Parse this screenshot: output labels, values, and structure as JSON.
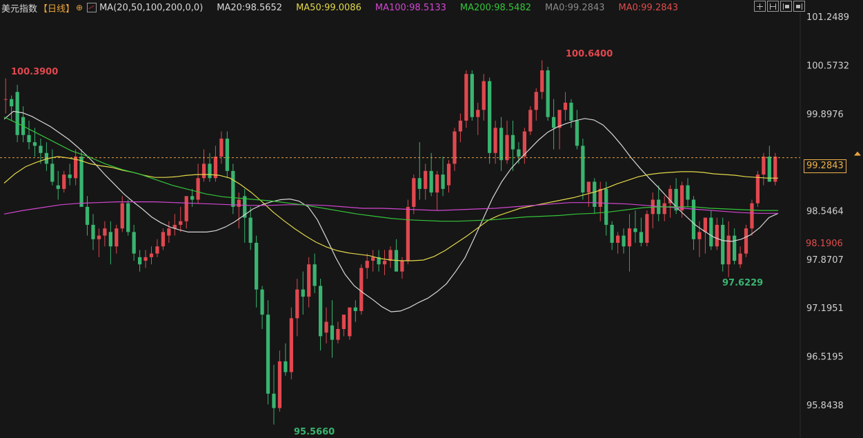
{
  "legend": {
    "instrument": "美元指数",
    "period": "【日线】",
    "period_ctrl": "⊕",
    "ma_params": "MA(20,50,100,200,0,0)",
    "items": [
      {
        "label": "MA20:98.5652",
        "color": "#d8d8d8"
      },
      {
        "label": "MA50:99.0086",
        "color": "#e3d94a"
      },
      {
        "label": "MA100:98.5133",
        "color": "#d347d3"
      },
      {
        "label": "MA200:98.5482",
        "color": "#34c63a"
      },
      {
        "label": "MA0:99.2843",
        "color": "#8a8a8a"
      },
      {
        "label": "MA0:99.2843",
        "color": "#e04c4c"
      }
    ]
  },
  "toolbar": [
    "zoom-in-icon",
    "zoom-out-icon",
    "step-left-icon",
    "step-right-icon"
  ],
  "price_tags": {
    "last": "99.2843",
    "ref": "98.1906"
  },
  "annotations": {
    "start_high": "100.3900",
    "peak_high": "100.6400",
    "low": "95.5660",
    "recent_low": "97.6229"
  },
  "chart_data": {
    "type": "candlestick",
    "y_ticks": [
      "101.2489",
      "100.5732",
      "99.8976",
      "99.2843",
      "98.5464",
      "98.1906",
      "97.8707",
      "97.1951",
      "96.5195",
      "95.8438"
    ],
    "ylim": [
      95.5,
      101.3
    ],
    "colors": {
      "up": "#e0484f",
      "down": "#39b470",
      "background": "#161616",
      "last_line": "#e8a33a"
    },
    "ohlc": [
      [
        100.1,
        100.39,
        99.9,
        100.1
      ],
      [
        100.1,
        100.15,
        99.8,
        100.0
      ],
      [
        100.2,
        100.3,
        99.5,
        99.6
      ],
      [
        99.85,
        100.0,
        99.5,
        99.6
      ],
      [
        99.6,
        99.8,
        99.4,
        99.5
      ],
      [
        99.5,
        99.7,
        99.3,
        99.45
      ],
      [
        99.45,
        99.55,
        99.2,
        99.35
      ],
      [
        99.35,
        99.5,
        99.1,
        99.2
      ],
      [
        99.2,
        99.4,
        98.9,
        98.95
      ],
      [
        98.9,
        99.1,
        98.7,
        98.85
      ],
      [
        98.85,
        99.1,
        98.8,
        99.05
      ],
      [
        99.05,
        99.2,
        98.9,
        99.0
      ],
      [
        99.0,
        99.4,
        98.9,
        99.3
      ],
      [
        99.3,
        99.4,
        98.6,
        98.6
      ],
      [
        98.6,
        98.75,
        98.2,
        98.35
      ],
      [
        98.35,
        98.5,
        98.0,
        98.15
      ],
      [
        98.15,
        98.3,
        97.9,
        98.2
      ],
      [
        98.2,
        98.4,
        98.05,
        98.3
      ],
      [
        98.25,
        98.4,
        97.8,
        98.05
      ],
      [
        98.05,
        98.35,
        97.95,
        98.3
      ],
      [
        98.3,
        98.75,
        98.25,
        98.65
      ],
      [
        98.65,
        98.7,
        98.2,
        98.25
      ],
      [
        98.25,
        98.35,
        97.85,
        97.95
      ],
      [
        97.9,
        98.0,
        97.7,
        97.8
      ],
      [
        97.85,
        98.0,
        97.75,
        97.9
      ],
      [
        97.9,
        98.05,
        97.8,
        97.95
      ],
      [
        97.95,
        98.15,
        97.9,
        98.05
      ],
      [
        98.05,
        98.3,
        98.0,
        98.25
      ],
      [
        98.2,
        98.4,
        98.1,
        98.3
      ],
      [
        98.3,
        98.5,
        98.2,
        98.35
      ],
      [
        98.35,
        98.6,
        98.25,
        98.4
      ],
      [
        98.4,
        98.7,
        98.3,
        98.75
      ],
      [
        98.75,
        98.85,
        98.6,
        98.7
      ],
      [
        98.7,
        99.2,
        98.65,
        99.0
      ],
      [
        99.0,
        99.4,
        98.95,
        99.2
      ],
      [
        99.2,
        99.35,
        98.95,
        99.0
      ],
      [
        99.0,
        99.45,
        98.95,
        99.3
      ],
      [
        99.3,
        99.65,
        99.2,
        99.55
      ],
      [
        99.55,
        99.65,
        99.0,
        99.1
      ],
      [
        99.1,
        99.2,
        98.5,
        98.6
      ],
      [
        98.6,
        98.8,
        98.3,
        98.7
      ],
      [
        98.75,
        98.85,
        98.1,
        98.45
      ],
      [
        98.45,
        98.6,
        98.0,
        98.1
      ],
      [
        98.1,
        98.2,
        97.2,
        97.45
      ],
      [
        97.45,
        97.5,
        96.9,
        97.1
      ],
      [
        97.1,
        97.3,
        95.85,
        96.0
      ],
      [
        96.0,
        96.4,
        95.57,
        95.8
      ],
      [
        95.8,
        96.6,
        95.75,
        96.45
      ],
      [
        96.45,
        96.7,
        96.25,
        96.3
      ],
      [
        96.3,
        97.2,
        96.2,
        97.05
      ],
      [
        97.05,
        97.6,
        96.8,
        97.45
      ],
      [
        97.45,
        97.7,
        97.1,
        97.35
      ],
      [
        97.35,
        97.9,
        97.2,
        97.8
      ],
      [
        97.8,
        97.95,
        97.4,
        97.5
      ],
      [
        97.5,
        97.6,
        96.6,
        96.8
      ],
      [
        96.85,
        97.2,
        96.7,
        97.0
      ],
      [
        96.95,
        97.3,
        96.5,
        96.75
      ],
      [
        96.75,
        97.0,
        96.7,
        96.9
      ],
      [
        96.9,
        97.1,
        96.8,
        97.1
      ],
      [
        96.8,
        97.2,
        96.75,
        97.2
      ],
      [
        97.2,
        97.3,
        97.0,
        97.15
      ],
      [
        97.15,
        97.8,
        97.1,
        97.75
      ],
      [
        97.75,
        97.95,
        97.6,
        97.85
      ],
      [
        97.85,
        98.0,
        97.7,
        97.9
      ],
      [
        97.9,
        98.0,
        97.7,
        97.8
      ],
      [
        97.8,
        98.0,
        97.65,
        97.85
      ],
      [
        97.85,
        98.05,
        97.75,
        98.0
      ],
      [
        98.0,
        98.15,
        97.7,
        97.7
      ],
      [
        97.7,
        97.9,
        97.6,
        97.85
      ],
      [
        97.85,
        98.7,
        97.8,
        98.6
      ],
      [
        98.6,
        99.05,
        98.5,
        99.0
      ],
      [
        99.0,
        99.5,
        98.7,
        98.85
      ],
      [
        98.85,
        99.2,
        98.7,
        99.1
      ],
      [
        99.1,
        99.35,
        98.75,
        98.8
      ],
      [
        98.8,
        99.1,
        98.55,
        99.05
      ],
      [
        99.05,
        99.3,
        98.75,
        98.85
      ],
      [
        98.9,
        99.25,
        98.8,
        99.2
      ],
      [
        99.2,
        99.7,
        99.1,
        99.65
      ],
      [
        99.65,
        99.9,
        99.5,
        99.8
      ],
      [
        99.8,
        100.5,
        99.7,
        100.45
      ],
      [
        100.45,
        100.5,
        99.8,
        99.85
      ],
      [
        99.85,
        100.05,
        99.6,
        99.95
      ],
      [
        99.95,
        100.45,
        99.8,
        100.35
      ],
      [
        100.35,
        100.4,
        99.2,
        99.35
      ],
      [
        99.35,
        99.8,
        99.2,
        99.7
      ],
      [
        99.7,
        99.85,
        99.1,
        99.25
      ],
      [
        99.25,
        99.8,
        99.2,
        99.6
      ],
      [
        99.6,
        99.8,
        99.1,
        99.4
      ],
      [
        99.4,
        99.5,
        99.2,
        99.3
      ],
      [
        99.3,
        99.7,
        99.2,
        99.65
      ],
      [
        99.65,
        100.0,
        99.6,
        99.95
      ],
      [
        99.95,
        100.25,
        99.8,
        100.2
      ],
      [
        100.2,
        100.64,
        100.1,
        100.5
      ],
      [
        100.5,
        100.55,
        99.8,
        99.85
      ],
      [
        99.85,
        100.1,
        99.4,
        99.7
      ],
      [
        99.7,
        99.9,
        99.4,
        99.95
      ],
      [
        99.95,
        100.2,
        99.8,
        100.05
      ],
      [
        100.05,
        100.1,
        99.7,
        99.8
      ],
      [
        99.8,
        99.95,
        99.4,
        99.45
      ],
      [
        99.45,
        99.55,
        98.7,
        98.8
      ],
      [
        98.8,
        98.95,
        98.6,
        98.95
      ],
      [
        98.95,
        99.0,
        98.5,
        98.6
      ],
      [
        98.6,
        98.95,
        98.4,
        98.85
      ],
      [
        98.85,
        98.95,
        98.2,
        98.35
      ],
      [
        98.35,
        98.4,
        98.0,
        98.1
      ],
      [
        98.1,
        98.25,
        97.95,
        98.2
      ],
      [
        98.2,
        98.3,
        97.95,
        98.05
      ],
      [
        98.05,
        98.5,
        97.7,
        98.3
      ],
      [
        98.3,
        98.55,
        98.1,
        98.25
      ],
      [
        98.25,
        98.45,
        98.05,
        98.1
      ],
      [
        98.1,
        98.55,
        98.05,
        98.5
      ],
      [
        98.5,
        98.8,
        98.3,
        98.7
      ],
      [
        98.7,
        98.9,
        98.4,
        98.5
      ],
      [
        98.5,
        98.75,
        98.4,
        98.65
      ],
      [
        98.65,
        98.9,
        98.45,
        98.85
      ],
      [
        98.85,
        99.0,
        98.5,
        98.55
      ],
      [
        98.55,
        98.95,
        98.45,
        98.9
      ],
      [
        98.9,
        99.0,
        98.6,
        98.7
      ],
      [
        98.7,
        98.75,
        98.0,
        98.15
      ],
      [
        98.15,
        98.4,
        97.9,
        98.25
      ],
      [
        98.25,
        98.45,
        97.95,
        98.45
      ],
      [
        98.45,
        98.55,
        98.0,
        98.05
      ],
      [
        98.05,
        98.45,
        98.0,
        98.35
      ],
      [
        98.35,
        98.45,
        97.7,
        97.8
      ],
      [
        97.8,
        98.4,
        97.62,
        98.2
      ],
      [
        98.2,
        98.3,
        97.8,
        97.85
      ],
      [
        97.8,
        98.05,
        97.75,
        97.95
      ],
      [
        97.95,
        98.35,
        97.9,
        98.3
      ],
      [
        98.3,
        98.7,
        98.2,
        98.65
      ],
      [
        98.65,
        99.1,
        98.6,
        99.05
      ],
      [
        99.05,
        99.35,
        98.9,
        99.3
      ],
      [
        99.3,
        99.45,
        98.95,
        98.95
      ],
      [
        98.95,
        99.35,
        98.9,
        99.3
      ]
    ],
    "ma_series": [
      {
        "label": "MA20",
        "color": "#d8d8d8",
        "values": [
          99.82,
          99.93,
          99.91,
          99.86,
          99.79,
          99.72,
          99.63,
          99.54,
          99.43,
          99.31,
          99.18,
          99.04,
          98.91,
          98.78,
          98.67,
          98.57,
          98.46,
          98.38,
          98.32,
          98.28,
          98.25,
          98.25,
          98.25,
          98.27,
          98.32,
          98.39,
          98.48,
          98.57,
          98.63,
          98.67,
          98.7,
          98.71,
          98.68,
          98.6,
          98.42,
          98.16,
          97.89,
          97.66,
          97.5,
          97.4,
          97.31,
          97.21,
          97.14,
          97.15,
          97.2,
          97.27,
          97.33,
          97.42,
          97.53,
          97.7,
          97.89,
          98.16,
          98.44,
          98.72,
          98.95,
          99.13,
          99.27,
          99.4,
          99.53,
          99.64,
          99.71,
          99.76,
          99.8,
          99.83,
          99.81,
          99.74,
          99.61,
          99.46,
          99.29,
          99.14,
          99.0,
          98.87,
          98.73,
          98.59,
          98.47,
          98.35,
          98.26,
          98.18,
          98.13,
          98.12,
          98.15,
          98.21,
          98.31,
          98.45,
          98.51
        ]
      },
      {
        "label": "MA50",
        "color": "#e3d94a",
        "values": [
          98.93,
          99.06,
          99.16,
          99.22,
          99.27,
          99.3,
          99.28,
          99.25,
          99.2,
          99.17,
          99.15,
          99.11,
          99.08,
          99.04,
          99.01,
          99.01,
          99.02,
          99.04,
          99.05,
          99.05,
          99.04,
          99.0,
          98.91,
          98.8,
          98.67,
          98.53,
          98.41,
          98.3,
          98.2,
          98.11,
          98.04,
          97.99,
          97.96,
          97.94,
          97.92,
          97.88,
          97.86,
          97.85,
          97.85,
          97.86,
          97.91,
          97.99,
          98.09,
          98.19,
          98.3,
          98.41,
          98.48,
          98.53,
          98.58,
          98.61,
          98.64,
          98.67,
          98.7,
          98.73,
          98.77,
          98.81,
          98.86,
          98.92,
          98.97,
          99.02,
          99.05,
          99.07,
          99.08,
          99.09,
          99.09,
          99.08,
          99.06,
          99.05,
          99.04,
          99.02,
          99.01,
          99.0,
          99.0
        ]
      },
      {
        "label": "MA100",
        "color": "#d347d3",
        "values": [
          98.5,
          98.55,
          98.59,
          98.63,
          98.65,
          98.66,
          98.67,
          98.67,
          98.67,
          98.66,
          98.65,
          98.64,
          98.63,
          98.62,
          98.62,
          98.63,
          98.63,
          98.62,
          98.6,
          98.58,
          98.58,
          98.57,
          98.56,
          98.55,
          98.56,
          98.57,
          98.58,
          98.6,
          98.62,
          98.64,
          98.66,
          98.66,
          98.65,
          98.64,
          98.62,
          98.6,
          98.58,
          98.56,
          98.54,
          98.52,
          98.51,
          98.51
        ]
      },
      {
        "label": "MA200",
        "color": "#34c63a",
        "values": [
          99.85,
          99.74,
          99.62,
          99.5,
          99.38,
          99.3,
          99.2,
          99.12,
          99.06,
          98.98,
          98.9,
          98.84,
          98.78,
          98.74,
          98.72,
          98.7,
          98.68,
          98.65,
          98.62,
          98.58,
          98.54,
          98.5,
          98.47,
          98.44,
          98.42,
          98.41,
          98.4,
          98.4,
          98.41,
          98.42,
          98.44,
          98.46,
          98.47,
          98.48,
          98.5,
          98.51,
          98.53,
          98.56,
          98.59,
          98.6,
          98.6,
          98.6,
          98.58,
          98.57,
          98.56,
          98.55,
          98.55
        ]
      }
    ]
  }
}
